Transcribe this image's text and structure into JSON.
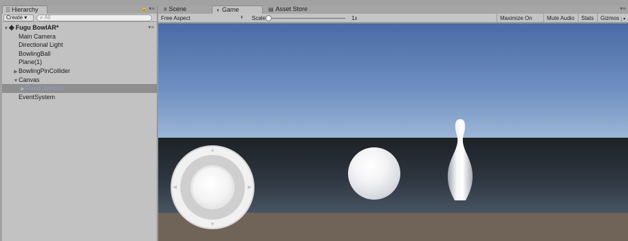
{
  "hierarchy": {
    "tab_label": "Hierarchy",
    "tab_icon": "list-icon",
    "create_label": "Create ▾",
    "search_placeholder": "All",
    "scene_name": "Fugu BowlAR*",
    "items": [
      {
        "label": "Main Camera"
      },
      {
        "label": "Directional Light"
      },
      {
        "label": "BowlingBall"
      },
      {
        "label": "Plane(1)"
      },
      {
        "label": "BowlingPinCollider"
      },
      {
        "label": "Canvas"
      },
      {
        "label": "Fixed Joystick"
      },
      {
        "label": "EventSystem"
      }
    ]
  },
  "game_view": {
    "tabs": [
      {
        "label": "Scene",
        "icon": "grid-icon"
      },
      {
        "label": "Game",
        "icon": "pacman-icon"
      },
      {
        "label": "Asset Store",
        "icon": "store-icon"
      }
    ],
    "active_tab": "Game",
    "aspect": "Free Aspect",
    "scale_label": "Scale",
    "scale_value": "1x",
    "scale_level": 0,
    "buttons": {
      "maximize": "Maximize On Play",
      "mute": "Mute Audio",
      "stats": "Stats",
      "gizmos": "Gizmos"
    }
  },
  "colors": {
    "selection_bg": "#8e8e8e",
    "selection_text": "#8f9dcf",
    "sky_top": "#4a6aa6",
    "horizon": "#dce7f1",
    "floor": "#706357"
  }
}
